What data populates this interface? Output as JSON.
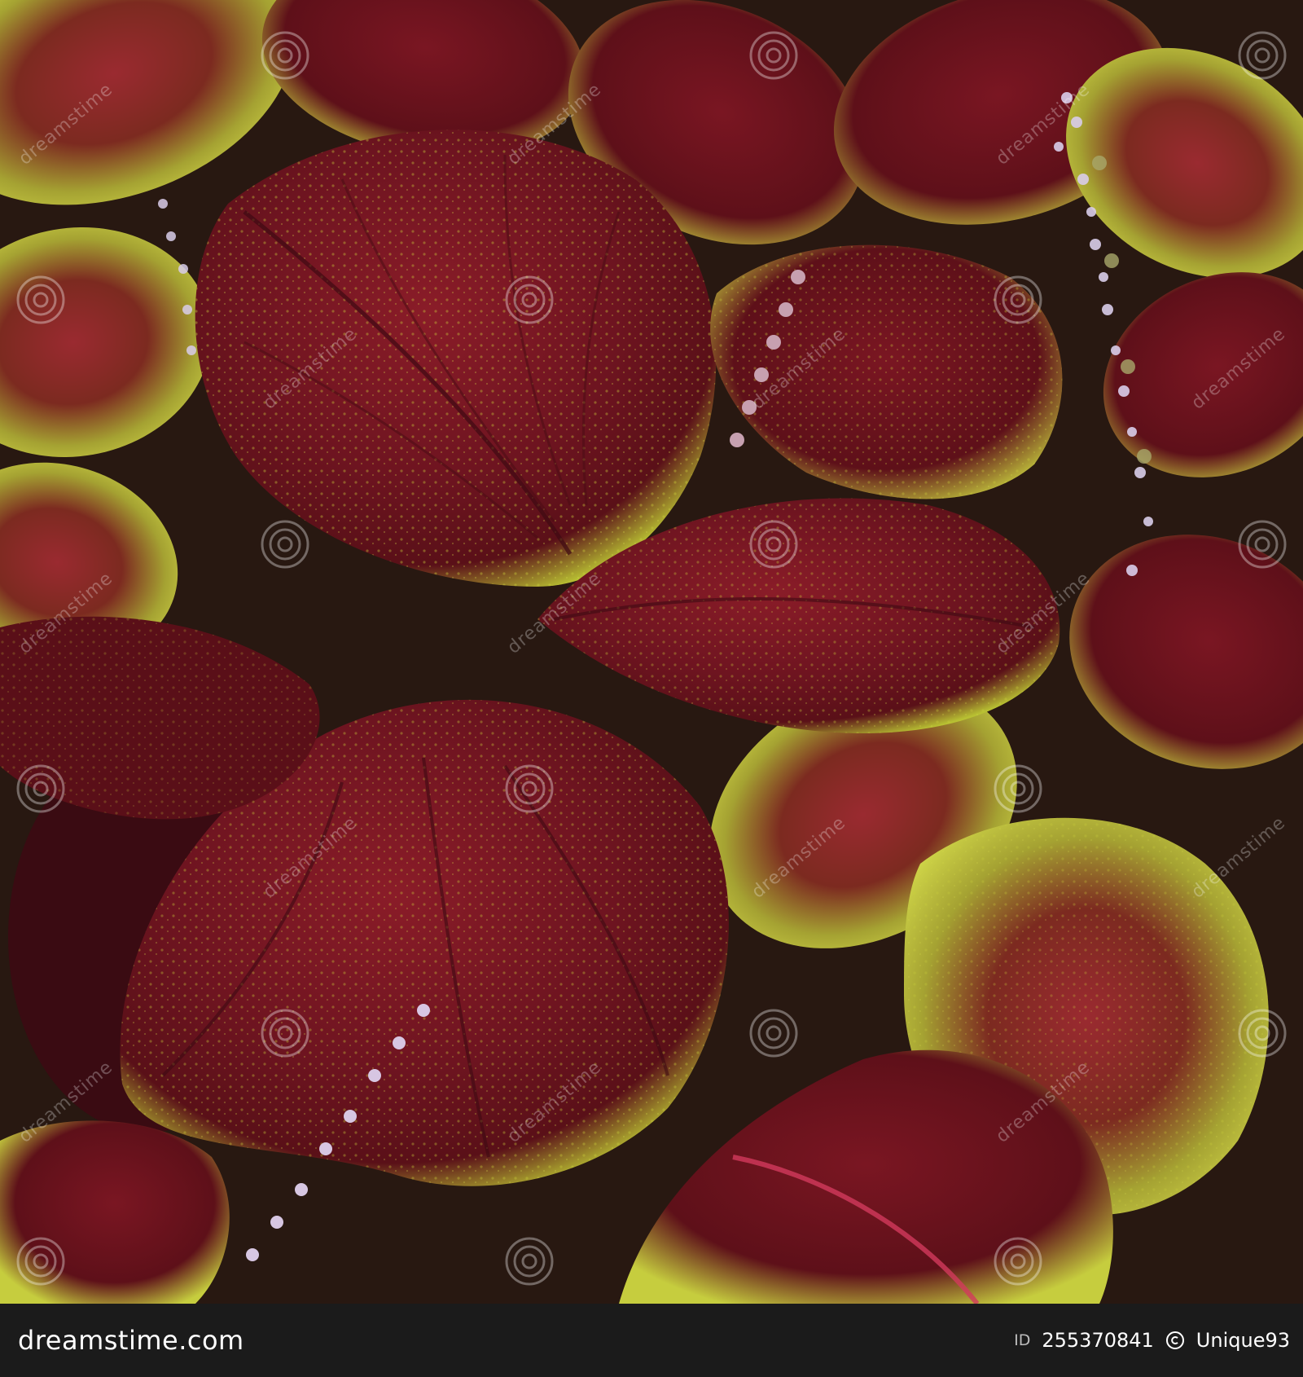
{
  "photo": {
    "subject": "coleus-plant",
    "colors": {
      "leaf_maroon": "#6e1420",
      "leaf_deep": "#4a0c14",
      "leaf_edge_lime": "#c9cf3a",
      "vein_pink": "#d23a5c",
      "flower_lilac": "#d9cdea",
      "footer_bg": "#1b1b1b"
    },
    "watermark_text": "dreamstime"
  },
  "footer": {
    "brand": "dreamstime.com",
    "id_label": "ID",
    "id_value": "255370841",
    "separator": "©",
    "author": "Unique93"
  }
}
